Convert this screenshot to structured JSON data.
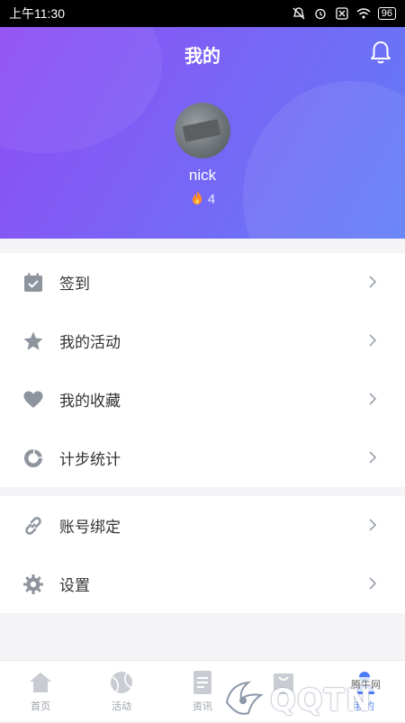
{
  "status": {
    "time": "上午11:30",
    "battery": "96"
  },
  "header": {
    "title": "我的",
    "username": "nick",
    "score": "4"
  },
  "menu_group1": [
    {
      "label": "签到",
      "icon": "calendar-check-icon"
    },
    {
      "label": "我的活动",
      "icon": "star-icon"
    },
    {
      "label": "我的收藏",
      "icon": "heart-icon"
    },
    {
      "label": "计步统计",
      "icon": "pie-chart-icon"
    }
  ],
  "menu_group2": [
    {
      "label": "账号绑定",
      "icon": "link-icon"
    },
    {
      "label": "设置",
      "icon": "gear-icon"
    }
  ],
  "tabs": [
    {
      "label": "首页",
      "icon": "home-icon"
    },
    {
      "label": "活动",
      "icon": "ball-icon"
    },
    {
      "label": "资讯",
      "icon": "document-icon"
    },
    {
      "label": "",
      "icon": "bag-icon"
    },
    {
      "label": "我的",
      "icon": "user-icon",
      "active": true
    }
  ],
  "watermark": {
    "brand": "QQTN",
    "site": "腾牛网"
  },
  "colors": {
    "accent": "#4c7bf6",
    "header_start": "#8f4cf4",
    "header_end": "#5f7df7",
    "icon_gray": "#8e949e"
  }
}
